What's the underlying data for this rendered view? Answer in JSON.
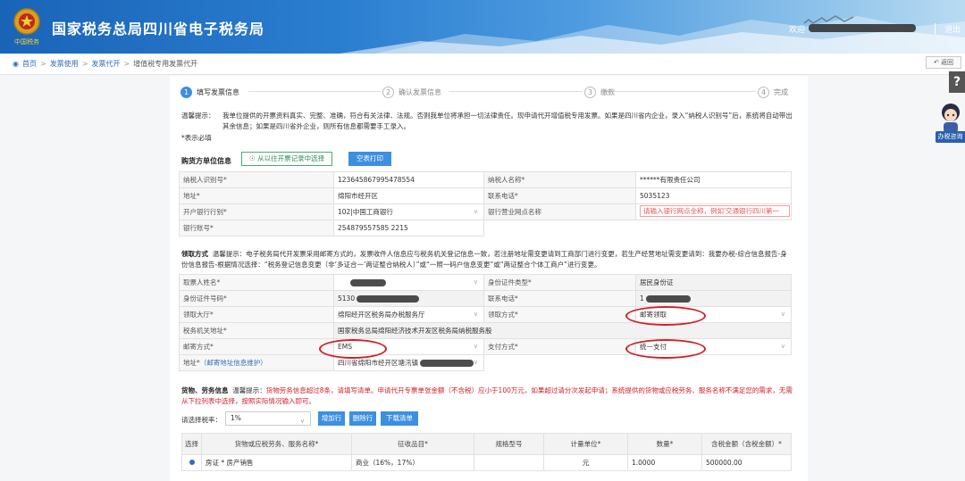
{
  "header": {
    "emblem_text": "中国税务",
    "site_title": "国家税务总局四川省电子税务局",
    "welcome": "欢迎",
    "logout": "退出"
  },
  "breadcrumb": {
    "home": "首页",
    "level1": "发票使用",
    "level2": "发票代开",
    "current": "增值税专用发票代开",
    "back": "返回"
  },
  "steps": [
    {
      "num": "1",
      "label": "填写发票信息"
    },
    {
      "num": "2",
      "label": "确认发票信息"
    },
    {
      "num": "3",
      "label": "缴款"
    },
    {
      "num": "4",
      "label": "完成"
    }
  ],
  "notice": {
    "lead": "温馨提示：",
    "text": "我单位提供的开票资料真实、完整、准确，符合有关法律、法规。否则我单位将承担一切法律责任。现申请代开增值税专用发票。如果是四川省内企业，录入“纳税人识别号”后，系统将自动带出其余信息；如果是四川省外企业，则所有信息都需要手工录入。",
    "required": "*表示必填"
  },
  "buyer": {
    "section": "购货方单位信息",
    "select_history_btn": "从以往开票记录中选择",
    "blank_print_btn": "空表打印",
    "taxpayer_id_label": "纳税人识别号*",
    "taxpayer_id": "123645867995478554",
    "taxpayer_name_label": "纳税人名称*",
    "taxpayer_name": "******有限责任公司",
    "address_label": "地址*",
    "address": "绵阳市经开区",
    "phone_label": "联系电话*",
    "phone": "5035123",
    "bank_label": "开户银行行别*",
    "bank": "102|中国工商银行",
    "branch_label": "银行营业网点名称",
    "branch_placeholder": "请输入银行网点全称，例如'交通银行四川第一",
    "account_label": "银行账号*",
    "account": "254879557585 2215"
  },
  "pickup": {
    "section": "领取方式",
    "notice": "温馨提示：电子税务局代开发票采用邮寄方式的，发票收件人信息应与税务机关登记信息一致，若注册地址需变更请到工商部门进行变更，若生产经营地址需变更请到：我要办税-综合信息报告-身份信息报告-根据情况选择：“税务登记信息变更（非‘多证合一’两证整合纳税人）”或“一照一码户信息变更”或“两证整合个体工商户”进行变更。",
    "receiver_label": "取票人姓名*",
    "id_type_label": "身份证件类型*",
    "id_type": "居民身份证",
    "id_no_label": "身份证件号码*",
    "id_no_prefix": "5130",
    "phone_label": "联系电话*",
    "phone_prefix": "1",
    "hall_label": "领取大厅*",
    "hall": "绵阳经开区税务局办税服务厅",
    "method_label": "领取方式*",
    "method": "邮寄领取",
    "org_address_label": "税务机关地址*",
    "org_address": "国家税务总局绵阳经济技术开发区税务局纳税服务股",
    "mail_method_label": "邮寄方式*",
    "mail_method": "EMS",
    "pay_method_label": "支付方式*",
    "pay_method": "统一支付",
    "address_label": "地址*",
    "address_maint": "（邮寄地址信息维护）",
    "address_prefix": "四川省绵阳市经开区塘汛镇"
  },
  "goods": {
    "section": "货物、劳务信息",
    "notice_lead": "温馨提示：",
    "notice_red": "货物劳务信息超过8条，请填写清单。申请代开专票单张金额（不含税）应小于100万元，如果超过请分次发起申请；",
    "notice_tail": "系统提供的货物或应税劳务、服务名称不满足您的需求，无需从下拉列表中选择，按照实际情况输入即可。",
    "rate_label": "请选择税率：",
    "rate": "1%",
    "add_btn": "增加行",
    "del_btn": "删除行",
    "download_btn": "下载清单",
    "columns": [
      "选择",
      "货物或应税劳务、服务名称*",
      "征收品目*",
      "规格型号",
      "计量单位*",
      "数量*",
      "含税金额（含税金额）*"
    ],
    "row": {
      "name": "房证 * 房产销售",
      "item": "商业（16%，17%）",
      "spec": "",
      "unit": "元",
      "qty": "1.0000",
      "amount": "500000.00"
    }
  },
  "float": {
    "help": "?",
    "assistant": "办税咨询"
  }
}
